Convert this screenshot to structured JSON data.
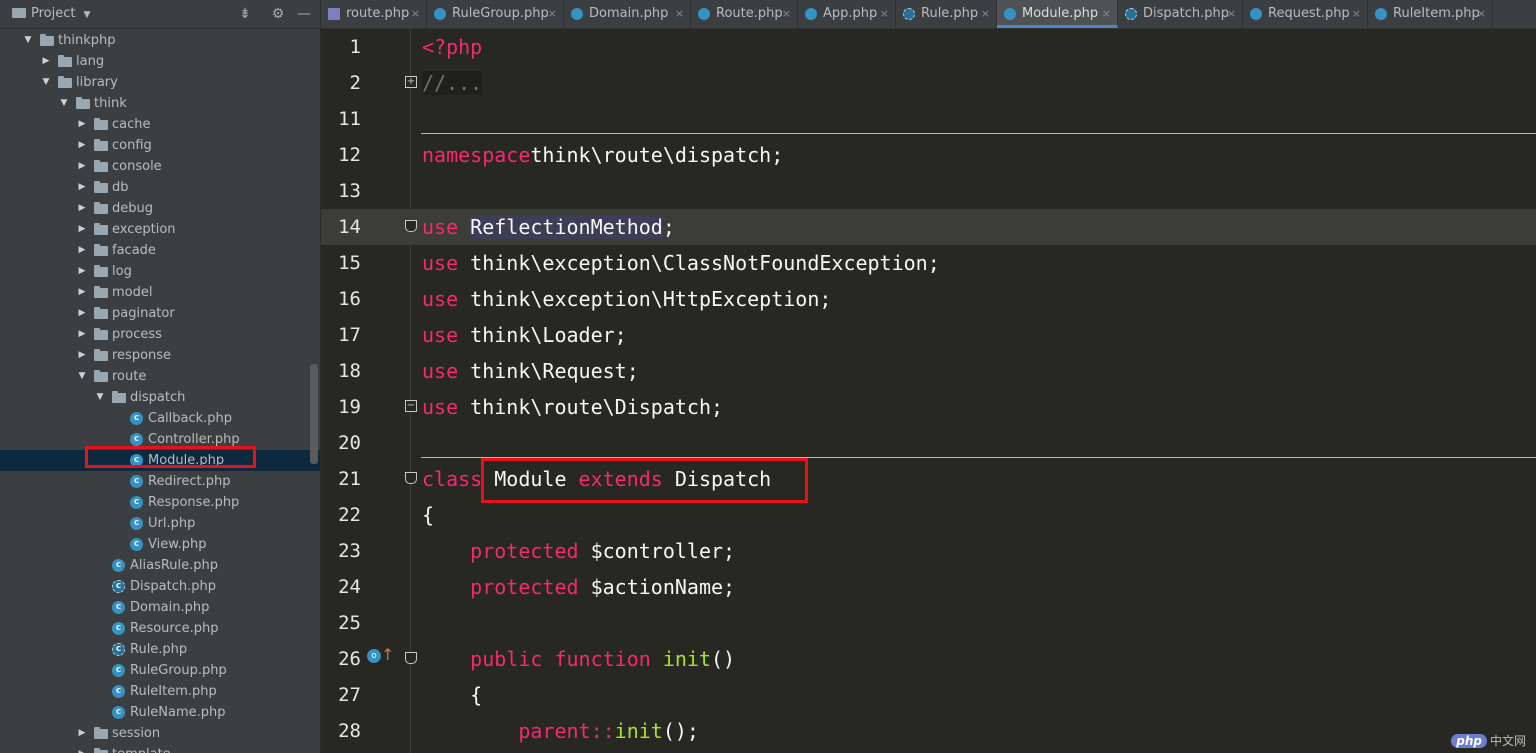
{
  "project": {
    "title": "Project",
    "tree": [
      {
        "label": "thinkphp",
        "type": "folder",
        "depth": 0,
        "expanded": true
      },
      {
        "label": "lang",
        "type": "folder",
        "depth": 1,
        "expanded": false
      },
      {
        "label": "library",
        "type": "folder",
        "depth": 1,
        "expanded": true
      },
      {
        "label": "think",
        "type": "folder",
        "depth": 2,
        "expanded": true
      },
      {
        "label": "cache",
        "type": "folder",
        "depth": 3,
        "expanded": false
      },
      {
        "label": "config",
        "type": "folder",
        "depth": 3,
        "expanded": false
      },
      {
        "label": "console",
        "type": "folder",
        "depth": 3,
        "expanded": false
      },
      {
        "label": "db",
        "type": "folder",
        "depth": 3,
        "expanded": false
      },
      {
        "label": "debug",
        "type": "folder",
        "depth": 3,
        "expanded": false
      },
      {
        "label": "exception",
        "type": "folder",
        "depth": 3,
        "expanded": false
      },
      {
        "label": "facade",
        "type": "folder",
        "depth": 3,
        "expanded": false
      },
      {
        "label": "log",
        "type": "folder",
        "depth": 3,
        "expanded": false
      },
      {
        "label": "model",
        "type": "folder",
        "depth": 3,
        "expanded": false
      },
      {
        "label": "paginator",
        "type": "folder",
        "depth": 3,
        "expanded": false
      },
      {
        "label": "process",
        "type": "folder",
        "depth": 3,
        "expanded": false
      },
      {
        "label": "response",
        "type": "folder",
        "depth": 3,
        "expanded": false
      },
      {
        "label": "route",
        "type": "folder",
        "depth": 3,
        "expanded": true
      },
      {
        "label": "dispatch",
        "type": "folder",
        "depth": 4,
        "expanded": true
      },
      {
        "label": "Callback.php",
        "type": "class",
        "depth": 5
      },
      {
        "label": "Controller.php",
        "type": "class",
        "depth": 5
      },
      {
        "label": "Module.php",
        "type": "class",
        "depth": 5,
        "selected": true
      },
      {
        "label": "Redirect.php",
        "type": "class",
        "depth": 5
      },
      {
        "label": "Response.php",
        "type": "class",
        "depth": 5
      },
      {
        "label": "Url.php",
        "type": "class",
        "depth": 5
      },
      {
        "label": "View.php",
        "type": "class",
        "depth": 5
      },
      {
        "label": "AliasRule.php",
        "type": "class",
        "depth": 4
      },
      {
        "label": "Dispatch.php",
        "type": "abstract",
        "depth": 4
      },
      {
        "label": "Domain.php",
        "type": "class",
        "depth": 4
      },
      {
        "label": "Resource.php",
        "type": "class",
        "depth": 4
      },
      {
        "label": "Rule.php",
        "type": "abstract",
        "depth": 4
      },
      {
        "label": "RuleGroup.php",
        "type": "class",
        "depth": 4
      },
      {
        "label": "RuleItem.php",
        "type": "class",
        "depth": 4
      },
      {
        "label": "RuleName.php",
        "type": "class",
        "depth": 4
      },
      {
        "label": "session",
        "type": "folder",
        "depth": 3,
        "expanded": false
      },
      {
        "label": "template",
        "type": "folder",
        "depth": 3,
        "expanded": false
      }
    ]
  },
  "tabs": [
    {
      "label": "route.php",
      "icon": "php"
    },
    {
      "label": "RuleGroup.php",
      "icon": "class"
    },
    {
      "label": "Domain.php",
      "icon": "class"
    },
    {
      "label": "Route.php",
      "icon": "class"
    },
    {
      "label": "App.php",
      "icon": "class"
    },
    {
      "label": "Rule.php",
      "icon": "abstract"
    },
    {
      "label": "Module.php",
      "icon": "class",
      "active": true
    },
    {
      "label": "Dispatch.php",
      "icon": "abstract"
    },
    {
      "label": "Request.php",
      "icon": "class"
    },
    {
      "label": "RuleItem.php",
      "icon": "class"
    }
  ],
  "editor": {
    "lines": [
      {
        "num": "1",
        "tokens": [
          [
            "kw",
            "<?php"
          ]
        ]
      },
      {
        "num": "2",
        "tokens": [
          [
            "collapsed",
            "//..."
          ]
        ],
        "fold": "plus"
      },
      {
        "num": "11",
        "tokens": [],
        "sep": true
      },
      {
        "num": "12",
        "tokens": [
          [
            "kw",
            "namespace"
          ],
          [
            "",
            "think\\route\\dispatch;"
          ]
        ]
      },
      {
        "num": "13",
        "tokens": []
      },
      {
        "num": "14",
        "tokens": [
          [
            "kw",
            "use"
          ],
          [
            "",
            " "
          ],
          [
            "useref",
            "ReflectionMethod"
          ],
          [
            "",
            ";"
          ]
        ],
        "current": true,
        "fold": "shield"
      },
      {
        "num": "15",
        "tokens": [
          [
            "kw",
            "use"
          ],
          [
            "",
            " think\\exception\\ClassNotFoundException;"
          ]
        ]
      },
      {
        "num": "16",
        "tokens": [
          [
            "kw",
            "use"
          ],
          [
            "",
            " think\\exception\\HttpException;"
          ]
        ]
      },
      {
        "num": "17",
        "tokens": [
          [
            "kw",
            "use"
          ],
          [
            "",
            " think\\Loader;"
          ]
        ]
      },
      {
        "num": "18",
        "tokens": [
          [
            "kw",
            "use"
          ],
          [
            "",
            " think\\Request;"
          ]
        ]
      },
      {
        "num": "19",
        "tokens": [
          [
            "kw",
            "use"
          ],
          [
            "",
            " think\\route\\Dispatch;"
          ]
        ],
        "fold": "minus"
      },
      {
        "num": "20",
        "tokens": [],
        "sep": true
      },
      {
        "num": "21",
        "tokens": [
          [
            "kw",
            "class"
          ],
          [
            "",
            " Module "
          ],
          [
            "kw",
            "extends"
          ],
          [
            "",
            " Dispatch"
          ]
        ],
        "fold": "shield"
      },
      {
        "num": "22",
        "tokens": [
          [
            "",
            "{"
          ]
        ]
      },
      {
        "num": "23",
        "tokens": [
          [
            "",
            "    "
          ],
          [
            "kw",
            "protected"
          ],
          [
            "",
            " $controller;"
          ]
        ]
      },
      {
        "num": "24",
        "tokens": [
          [
            "",
            "    "
          ],
          [
            "kw",
            "protected"
          ],
          [
            "",
            " $actionName;"
          ]
        ]
      },
      {
        "num": "25",
        "tokens": []
      },
      {
        "num": "26",
        "tokens": [
          [
            "",
            "    "
          ],
          [
            "kw",
            "public"
          ],
          [
            "",
            " "
          ],
          [
            "kw",
            "function"
          ],
          [
            "",
            " "
          ],
          [
            "fn",
            "init"
          ],
          [
            "",
            "()"
          ]
        ],
        "fold": "shield",
        "gutter": true
      },
      {
        "num": "27",
        "tokens": [
          [
            "",
            "    {"
          ]
        ]
      },
      {
        "num": "28",
        "tokens": [
          [
            "",
            "        "
          ],
          [
            "kw",
            "parent"
          ],
          [
            "op",
            "::"
          ],
          [
            "fn",
            "init"
          ],
          [
            "",
            "();"
          ]
        ]
      }
    ]
  },
  "watermark": {
    "logo": "php",
    "text": "中文网"
  },
  "colors": {
    "keyword": "#f92672",
    "function": "#a6e22e",
    "highlight": "#e8101a",
    "selection": "#0d293e"
  }
}
